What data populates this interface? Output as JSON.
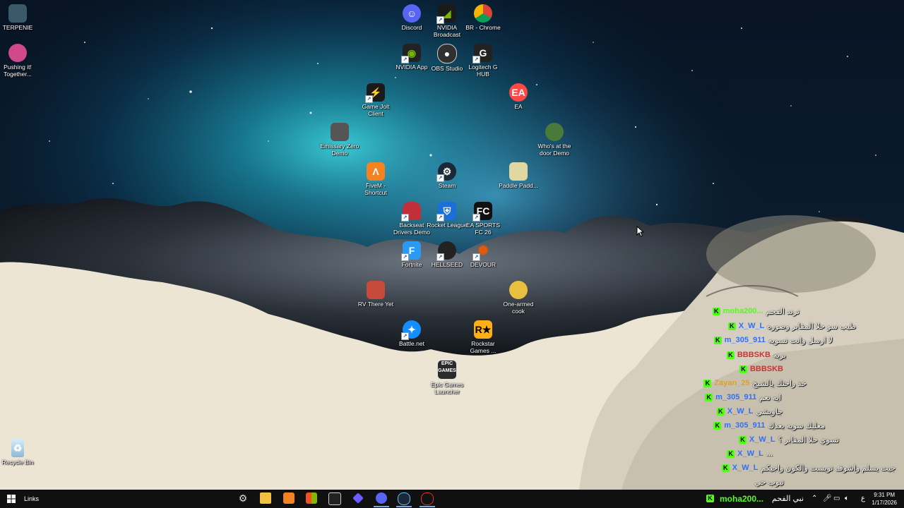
{
  "desktop_icons": [
    {
      "label": "TERPENIE",
      "icon": "app-icon",
      "color": "#3a5a6a"
    },
    {
      "label": "Pushing it! Together...",
      "icon": "game-icon",
      "color": "#d04a8a"
    },
    {
      "label": "Discord",
      "icon": "discord-icon",
      "color": "#5865f2"
    },
    {
      "label": "NVIDIA Broadcast",
      "icon": "nvidia-broadcast-icon",
      "color": "#76b900"
    },
    {
      "label": "BR - Chrome",
      "icon": "chrome-icon",
      "color": "#db4437"
    },
    {
      "label": "NVIDIA App",
      "icon": "nvidia-icon",
      "color": "#76b900"
    },
    {
      "label": "OBS Studio",
      "icon": "obs-icon",
      "color": "#303030"
    },
    {
      "label": "Logitech G HUB",
      "icon": "logitech-icon",
      "color": "#222222"
    },
    {
      "label": "Game Jolt Client",
      "icon": "gamejolt-icon",
      "color": "#ccff00"
    },
    {
      "label": "EA",
      "icon": "ea-icon",
      "color": "#ff4747"
    },
    {
      "label": "Emissary Zero Demo",
      "icon": "game-icon",
      "color": "#555555"
    },
    {
      "label": "Who's at the door Demo",
      "icon": "game-icon",
      "color": "#4a7a3a"
    },
    {
      "label": "FiveM - Shortcut",
      "icon": "fivem-icon",
      "color": "#f58220"
    },
    {
      "label": "Steam",
      "icon": "steam-icon",
      "color": "#1b2838"
    },
    {
      "label": "Paddle Padd...",
      "icon": "game-icon",
      "color": "#e0d8a0"
    },
    {
      "label": "Backseat Drivers Demo",
      "icon": "game-icon",
      "color": "#c0303a"
    },
    {
      "label": "Rocket League",
      "icon": "rocket-league-icon",
      "color": "#1a6fd8"
    },
    {
      "label": "EA SPORTS FC 26",
      "icon": "fc-icon",
      "color": "#111111"
    },
    {
      "label": "Fortnite",
      "icon": "fortnite-icon",
      "color": "#2b9af3"
    },
    {
      "label": "HELLSEED",
      "icon": "game-icon",
      "color": "#222222"
    },
    {
      "label": "DEVOUR",
      "icon": "devour-icon",
      "color": "#e05a10"
    },
    {
      "label": "RV There Yet",
      "icon": "game-icon",
      "color": "#c84a3a"
    },
    {
      "label": "One-armed cook",
      "icon": "game-icon",
      "color": "#e8c040"
    },
    {
      "label": "Battle.net",
      "icon": "battlenet-icon",
      "color": "#148eff"
    },
    {
      "label": "Rockstar Games ...",
      "icon": "rockstar-icon",
      "color": "#fcaf17"
    },
    {
      "label": "Epic Games Launcher",
      "icon": "epic-icon",
      "color": "#2a2a2a"
    },
    {
      "label": "Recycle Bin",
      "icon": "recycle-bin-icon",
      "color": "#9ac8e8"
    }
  ],
  "chat": {
    "lines": [
      {
        "user": "moha200...",
        "message": "ترند الفحم",
        "color": "#53fc18"
      },
      {
        "user": "X_W_L",
        "message": "طيب سو حلا المقابر وصوره",
        "color": "#2f6fff"
      },
      {
        "user": "m_305_911",
        "message": "لا ارسل وانت تسويه",
        "color": "#2f6fff"
      },
      {
        "user": "BBBSKB",
        "message": "بريه",
        "color": "#d03030"
      },
      {
        "user": "BBBSKB",
        "message": "",
        "color": "#d03030"
      },
      {
        "user": "Zayan_25",
        "message": "خذ راحتك يالشيخ",
        "color": "#e0a020"
      },
      {
        "user": "m_305_911",
        "message": "ايه نعم",
        "color": "#2f6fff"
      },
      {
        "user": "X_W_L",
        "message": "جاويشي",
        "color": "#2f6fff"
      },
      {
        "user": "m_305_911",
        "message": "معليك سويه بعدك",
        "color": "#2f6fff"
      },
      {
        "user": "X_W_L",
        "message": "تسوي حلا المقابر ؟",
        "color": "#2f6fff"
      },
      {
        "user": "X_W_L",
        "message": "...",
        "color": "#2f6fff"
      },
      {
        "user": "X_W_L",
        "message": "جيت يسلم واشوف تويست والكون واجيكم",
        "color": "#2f6fff"
      },
      {
        "user": "",
        "message": "تيوب حي",
        "color": "#2f6fff"
      }
    ]
  },
  "taskbar": {
    "links_label": "Links",
    "apps": [
      {
        "name": "settings-icon",
        "color": "#cccccc"
      },
      {
        "name": "file-explorer-icon",
        "color": "#f0c040"
      },
      {
        "name": "fivem-taskbar-icon",
        "color": "#f58220"
      },
      {
        "name": "store-icon",
        "color": "#3c8ee0"
      },
      {
        "name": "capcut-icon",
        "color": "#dddddd"
      },
      {
        "name": "app-icon",
        "color": "#6a5cff"
      },
      {
        "name": "discord-taskbar-icon",
        "color": "#5865f2"
      },
      {
        "name": "steam-taskbar-icon",
        "color": "#66c0f4"
      },
      {
        "name": "obs-taskbar-icon",
        "color": "#e03030"
      }
    ],
    "tray_user": "moha200...",
    "tray_message": "نبي الفحم",
    "tray_user_color": "#53fc18",
    "lang": "ع",
    "time": "9:31 PM",
    "date": "1/17/2026"
  }
}
